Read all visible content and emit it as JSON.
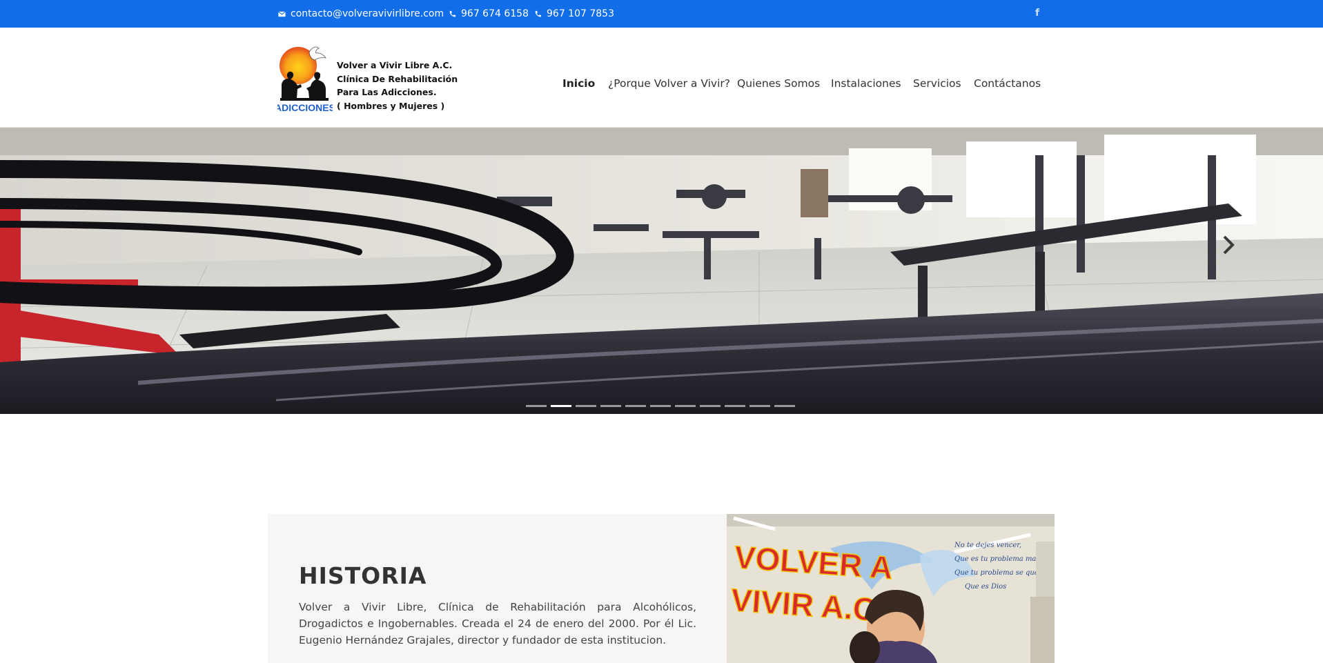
{
  "topbar": {
    "email": "contacto@volveravivirlibre.com",
    "phone1": "967 674 6158",
    "phone2": "967 107 7853",
    "facebook": "f"
  },
  "brand": {
    "logo_text": "ADICCIONES",
    "lines": [
      "Volver a Vivir Libre A.C.",
      "Clínica De Rehabilitación",
      "Para Las Adicciones.",
      "( Hombres y Mujeres )"
    ]
  },
  "nav": [
    {
      "label": "Inicio",
      "active": true
    },
    {
      "label": "¿Porque Volver a Vivir?"
    },
    {
      "label": "Quienes Somos"
    },
    {
      "label": "Instalaciones"
    },
    {
      "label": "Servicios"
    },
    {
      "label": "Contáctanos"
    }
  ],
  "slider": {
    "slide_count": 11,
    "active_index": 1
  },
  "historia": {
    "title": "HISTORIA",
    "text": "Volver a Vivir Libre, Clínica de Rehabilitación para Alcohólicos, Drogadictos e Ingobernables. Creada el 24 de enero del 2000. Por él Lic. Eugenio Hernández Grajales, director y fundador de esta institucion."
  },
  "mural": {
    "line1": "VOLVER A",
    "line2": "VIVIR A.C",
    "verse": [
      "No te dejes vencer,",
      "Que es tu problema mayor",
      "Que tu problema se queda",
      "Que es Dios"
    ]
  },
  "colors": {
    "topbar": "#126ee8",
    "accent_red": "#d82a2a"
  }
}
